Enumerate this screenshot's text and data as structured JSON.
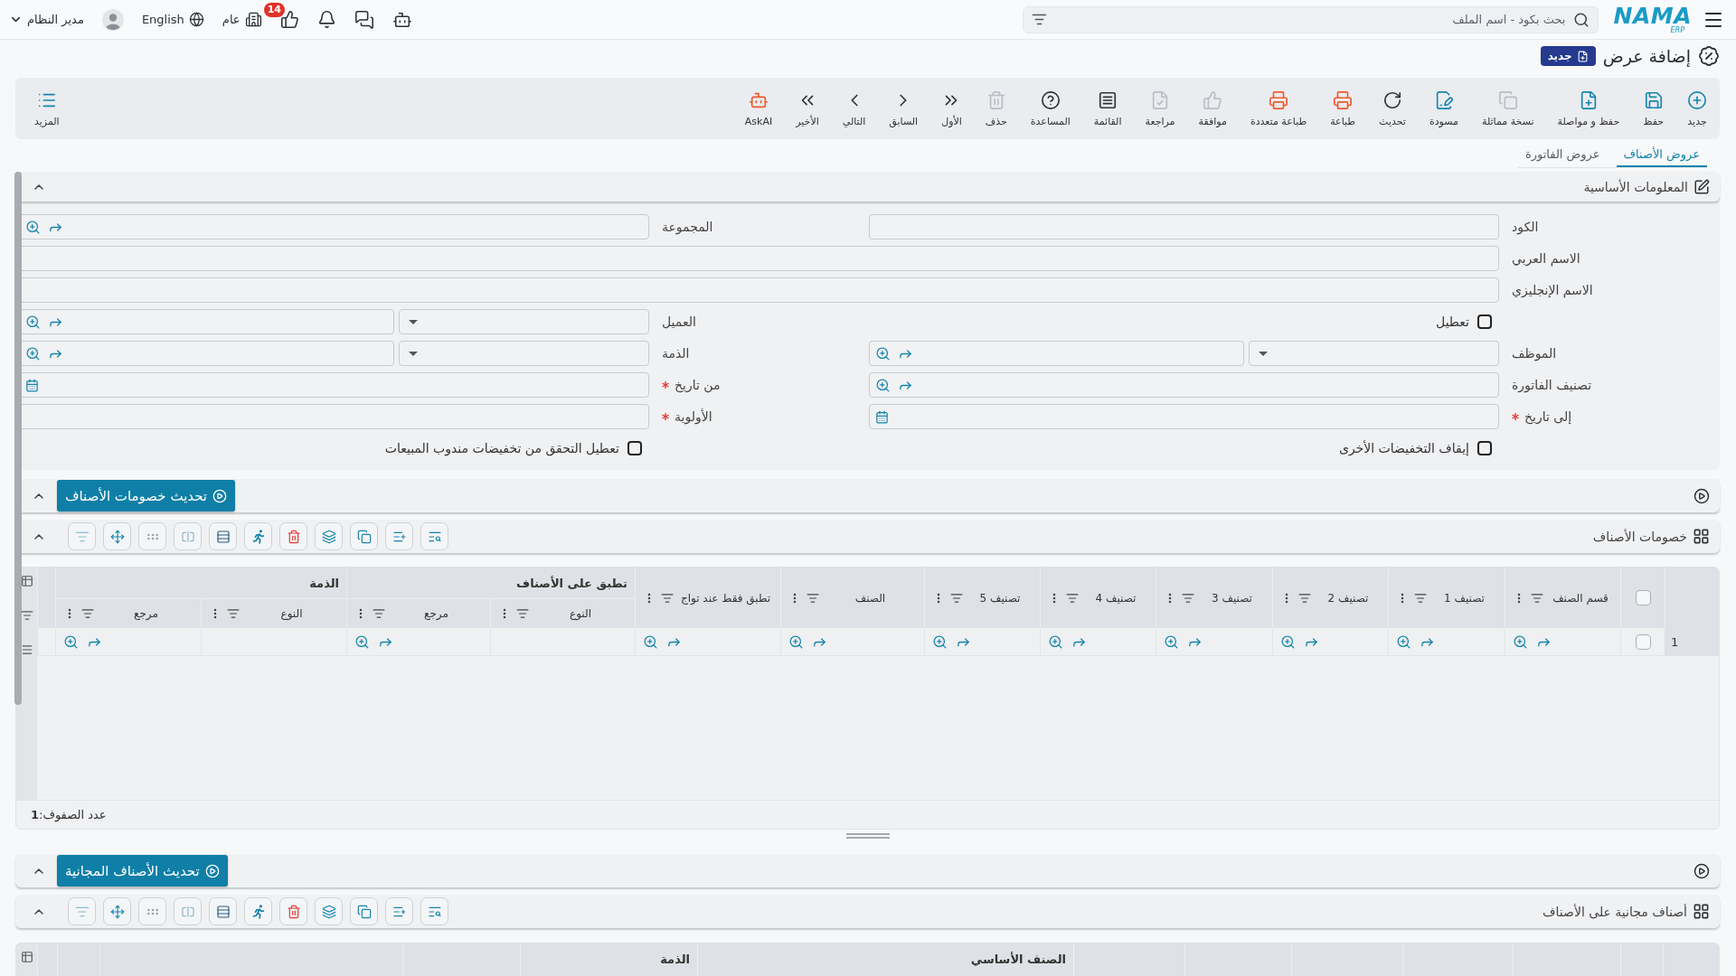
{
  "top_bar": {
    "logo": {
      "text": "NAMA",
      "subtext": "ERP"
    },
    "search": {
      "placeholder": "بحث بكود - اسم الملف"
    },
    "notifications": {
      "badge": "14"
    },
    "branch": "عام",
    "language": "English",
    "user": "مدير النظام"
  },
  "page": {
    "title": "إضافة عرض",
    "status": "جديد"
  },
  "toolbar": {
    "actions": [
      {
        "label": "جديد",
        "disabled": false
      },
      {
        "label": "حفظ",
        "disabled": false
      },
      {
        "label": "حفظ و مواصلة",
        "disabled": false
      },
      {
        "label": "نسخة مماثلة",
        "disabled": true
      },
      {
        "label": "مسودة",
        "disabled": false
      },
      {
        "label": "تحديث",
        "disabled": false
      },
      {
        "label": "طباعة",
        "disabled": false
      },
      {
        "label": "طباعة متعددة",
        "disabled": false
      },
      {
        "label": "موافقة",
        "disabled": true
      },
      {
        "label": "مراجعة",
        "disabled": true
      },
      {
        "label": "القائمة",
        "disabled": false
      },
      {
        "label": "المساعدة",
        "disabled": false
      },
      {
        "label": "حذف",
        "disabled": true
      },
      {
        "label": "الأول",
        "disabled": false
      },
      {
        "label": "السابق",
        "disabled": false
      },
      {
        "label": "التالي",
        "disabled": false
      },
      {
        "label": "الأخير",
        "disabled": false
      },
      {
        "label": "AskAI",
        "disabled": false
      }
    ],
    "more": "المزيد"
  },
  "tabs": [
    {
      "label": "عروض الأصناف",
      "selected": true
    },
    {
      "label": "عروض الفاتورة",
      "selected": false
    }
  ],
  "basic_info": {
    "title": "المعلومات الأساسية",
    "expanded": true,
    "rows": [
      [
        {
          "kind": "text",
          "label": "الكود",
          "required": false
        },
        {
          "kind": "lookup",
          "label": "المجموعة",
          "required": false
        }
      ],
      [
        {
          "kind": "text",
          "label": "الاسم العربي",
          "required": false
        }
      ],
      [
        {
          "kind": "text",
          "label": "الاسم الإنجليزي",
          "required": false
        }
      ],
      [
        {
          "kind": "checkbox",
          "label": "تعطيل",
          "checked": false
        },
        {
          "kind": "select_lookup",
          "label": "العميل",
          "required": false
        }
      ],
      [
        {
          "kind": "select_lookup",
          "label": "الموظف",
          "required": false
        },
        {
          "kind": "select_lookup",
          "label": "الذمة",
          "required": false
        }
      ],
      [
        {
          "kind": "lookup",
          "label": "تصنيف الفاتورة",
          "required": false
        },
        {
          "kind": "date",
          "label": "من تاريخ",
          "required": true
        }
      ],
      [
        {
          "kind": "date",
          "label": "إلى تاريخ",
          "required": true
        },
        {
          "kind": "text",
          "label": "الأولوية",
          "required": true
        }
      ],
      [
        {
          "kind": "checkbox",
          "label": "إيقاف التخفيضات الأخرى",
          "checked": false
        },
        {
          "kind": "checkbox",
          "label": "تعطيل التحقق من تخفيضات مندوب المبيعات",
          "checked": false
        }
      ]
    ]
  },
  "item_discounts": {
    "action": "تحديث خصومات الأصناف",
    "expanded": true,
    "grid": {
      "title": "خصومات الأصناف",
      "expanded": true,
      "select_all": {
        "checked": false
      },
      "columns": [
        {
          "label": "قسم الصنف",
          "kind": "lookup"
        },
        {
          "label": "تصنيف 1",
          "kind": "lookup"
        },
        {
          "label": "تصنيف 2",
          "kind": "lookup"
        },
        {
          "label": "تصنيف 3",
          "kind": "lookup"
        },
        {
          "label": "تصنيف 4",
          "kind": "lookup"
        },
        {
          "label": "تصنيف 5",
          "kind": "lookup"
        },
        {
          "label": "الصنف",
          "kind": "lookup"
        },
        {
          "label": "تطبق فقط عند تواج",
          "kind": "lookup"
        },
        {
          "label": "تطبق على الأصناف",
          "children": [
            {
              "label": "النوع",
              "kind": "select"
            },
            {
              "label": "مرجع",
              "kind": "lookup"
            }
          ]
        },
        {
          "label": "الذمة",
          "children": [
            {
              "label": "النوع",
              "kind": "select"
            },
            {
              "label": "مرجع",
              "kind": "lookup"
            }
          ]
        }
      ],
      "rows": [
        {
          "number": "1",
          "checked": false
        }
      ],
      "row_count": "عدد الصفوف:**1**"
    }
  },
  "free_items": {
    "action": "تحديث الأصناف المجانية",
    "expanded": true,
    "grid": {
      "title": "أصناف مجانية على الأصناف",
      "expanded": true,
      "column_groups": [
        {
          "label": "الصنف الأساسي"
        },
        {
          "label": "الذمة"
        }
      ]
    }
  }
}
